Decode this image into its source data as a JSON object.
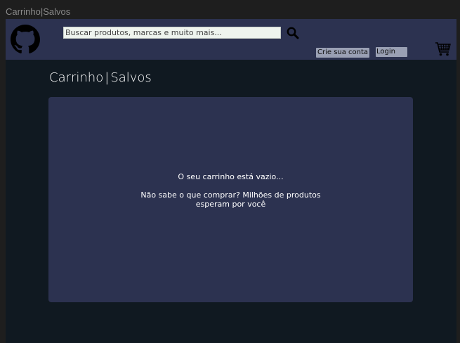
{
  "window": {
    "title": "Carrinho|Salvos"
  },
  "header": {
    "logo_icon": "github-icon",
    "search": {
      "placeholder": "Buscar produtos, marcas e muito mais...",
      "value": ""
    },
    "search_icon": "search-icon",
    "signup_label": "Crie sua conta",
    "login_label": "Login",
    "cart_icon": "shopping-cart-icon"
  },
  "main": {
    "title_cart": "Carrinho",
    "title_sep": "|",
    "title_saved": "Salvos",
    "empty_message": "O seu carrinho está vazio...",
    "empty_suggestion": "Não sabe o que comprar? Milhões de produtos esperam por você"
  },
  "colors": {
    "header_bg": "#2c3250",
    "page_bg": "#101921",
    "panel_bg": "#2c3250",
    "button_bg": "#9aa0b4"
  }
}
